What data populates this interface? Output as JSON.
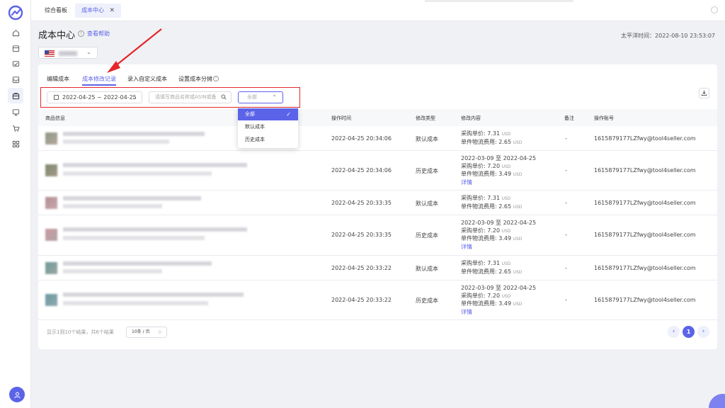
{
  "app": {
    "accent": "#5b63e8"
  },
  "rail": {
    "icons": [
      "logo-icon",
      "home-icon",
      "package-icon",
      "chart-check-icon",
      "inbox-icon",
      "cost-box-icon",
      "monitor-icon",
      "cart-icon",
      "grid-icon",
      "user-icon"
    ]
  },
  "tabs": [
    {
      "label": "综合看板"
    },
    {
      "label": "成本中心"
    }
  ],
  "header": {
    "title": "成本中心",
    "help": "查看帮助",
    "time": "太平洋时间：2022-08-10 23:53:07"
  },
  "subtabs": [
    {
      "label": "编辑成本"
    },
    {
      "label": "成本修改记录"
    },
    {
      "label": "录入自定义成本"
    },
    {
      "label": "设置成本分摊"
    }
  ],
  "filters": {
    "date_range": "2022-04-25 ~ 2022-04-25",
    "search_placeholder": "请填写商品名称或ASIN或备",
    "type_placeholder": "全部"
  },
  "dropdown": {
    "options": [
      {
        "label": "全部",
        "selected": true
      },
      {
        "label": "默认成本",
        "selected": false
      },
      {
        "label": "历史成本",
        "selected": false
      }
    ]
  },
  "table": {
    "headers": [
      "商品信息",
      "操作时间",
      "修改类型",
      "修改内容",
      "备注",
      "操作账号"
    ],
    "rows": [
      {
        "time": "2022-04-25 20:34:06",
        "type": "默认成本",
        "range": "",
        "price": "采购单价: 7.31",
        "logistics": "单件物流费用: 2.65",
        "unit": "USD",
        "detail": "",
        "note": "-",
        "account": "1615879177LZfwy@tool4seller.com"
      },
      {
        "time": "2022-04-25 20:34:06",
        "type": "历史成本",
        "range": "2022-03-09 至 2022-04-25",
        "price": "采购单价: 7.20",
        "logistics": "单件物流费用: 3.49",
        "unit": "USD",
        "detail": "详情",
        "note": "-",
        "account": "1615879177LZfwy@tool4seller.com"
      },
      {
        "time": "2022-04-25 20:33:35",
        "type": "默认成本",
        "range": "",
        "price": "采购单价: 7.31",
        "logistics": "单件物流费用: 2.65",
        "unit": "USD",
        "detail": "",
        "note": "-",
        "account": "1615879177LZfwy@tool4seller.com"
      },
      {
        "time": "2022-04-25 20:33:35",
        "type": "历史成本",
        "range": "2022-03-09 至 2022-04-25",
        "price": "采购单价: 7.20",
        "logistics": "单件物流费用: 3.49",
        "unit": "USD",
        "detail": "详情",
        "note": "-",
        "account": "1615879177LZfwy@tool4seller.com"
      },
      {
        "time": "2022-04-25 20:33:22",
        "type": "默认成本",
        "range": "",
        "price": "采购单价: 7.31",
        "logistics": "单件物流费用: 2.65",
        "unit": "USD",
        "detail": "",
        "note": "-",
        "account": "1615879177LZfwy@tool4seller.com"
      },
      {
        "time": "2022-04-25 20:33:22",
        "type": "历史成本",
        "range": "2022-03-09 至 2022-04-25",
        "price": "采购单价: 7.20",
        "logistics": "单件物流费用: 3.49",
        "unit": "USD",
        "detail": "详情",
        "note": "-",
        "account": "1615879177LZfwy@tool4seller.com"
      }
    ]
  },
  "footer": {
    "total": "显示1到10个结果，共6个结果",
    "page_size": "10条 / 页",
    "current_page": "1"
  }
}
